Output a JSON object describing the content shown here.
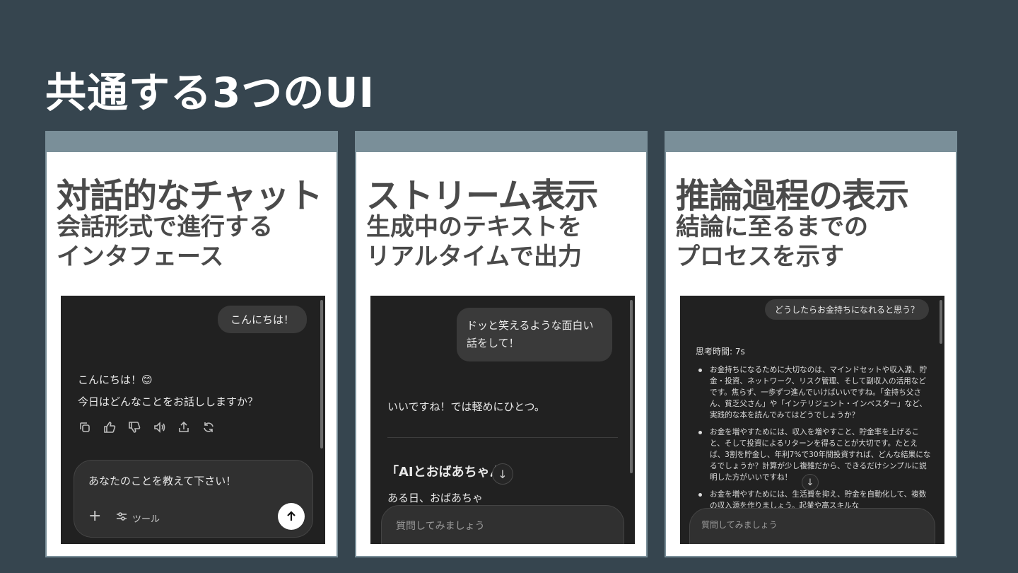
{
  "title": "共通する3つのUI",
  "cards": [
    {
      "heading": "対話的なチャット",
      "sub_line1": "会話形式で進行する",
      "sub_line2": "インタフェース",
      "shot": {
        "user_message": "こんにちは！",
        "reply_line1": "こんにちは！😊",
        "reply_line2": "今日はどんなことをお話ししますか？",
        "action_icons": [
          "copy-icon",
          "thumbs-up-icon",
          "thumbs-down-icon",
          "speaker-icon",
          "share-icon",
          "regenerate-icon"
        ],
        "input_text": "あなたのことを教えて下さい！",
        "tools_label": "ツール"
      }
    },
    {
      "heading": "ストリーム表示",
      "sub_line1": "生成中のテキストを",
      "sub_line2": "リアルタイムで出力",
      "shot": {
        "user_message": "ドッと笑えるような面白い話をして！",
        "reply_intro": "いいですね！では軽めにひとつ。",
        "story_title": "「AIとおばあちゃん」",
        "story_start": "ある日、おばあちゃ",
        "input_placeholder": "質問してみましょう"
      }
    },
    {
      "heading": "推論過程の表示",
      "sub_line1": "結論に至るまでの",
      "sub_line2": "プロセスを示す",
      "shot": {
        "user_message": "どうしたらお金持ちになれると思う？",
        "thinking_time": "思考時間: 7s",
        "bullets": [
          "お金持ちになるために大切なのは、マインドセットや収入源、貯金・投資、ネットワーク、リスク管理、そして副収入の活用などです。焦らず、一歩ずつ進んでいけばいいですね。「金持ち父さん、貧乏父さん」や「インテリジェント・インベスター」など、実践的な本を読んでみてはどうでしょうか？",
          "お金を増やすためには、収入を増やすこと、貯金率を上げること、そして投資によるリターンを得ることが大切です。たとえば、3割を貯金し、年利7%で30年間投資すれば、どんな結果になるでしょうか？計算が少し複雑だから、できるだけシンプルに説明した方がいいですね！",
          "お金を増やすためには、生活費を抑え、貯金を自動化して、複数の収入源を作りましょう。起業や高スキルな"
        ],
        "input_placeholder": "質問してみましょう"
      }
    }
  ]
}
